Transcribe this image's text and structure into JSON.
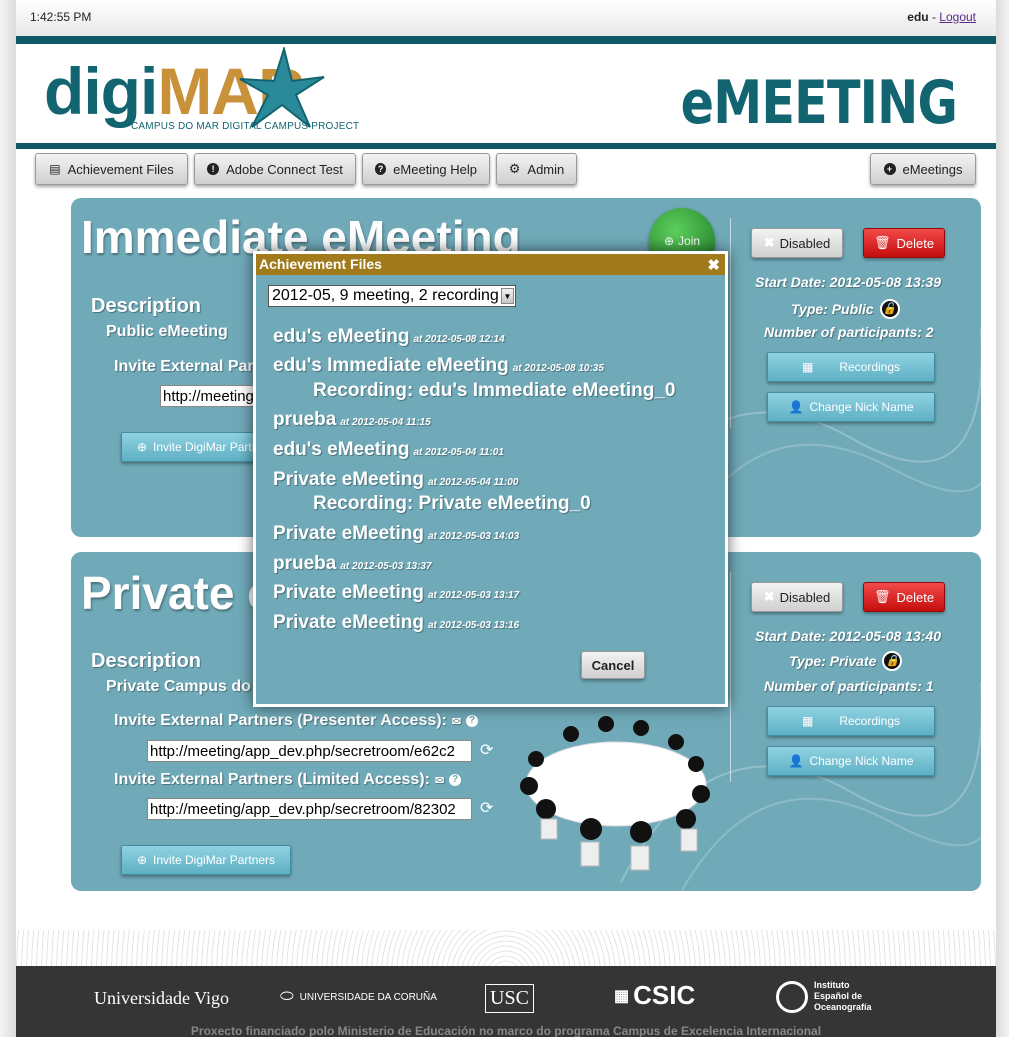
{
  "topbar": {
    "clock": "1:42:55 PM",
    "user": "edu",
    "separator": " - ",
    "logout": "Logout"
  },
  "header": {
    "logo_digi": "digi",
    "logo_mar": "MAR",
    "logo_subtitle": "CAMPUS DO MAR DIGITAL CAMPUS PROJECT",
    "title": "eMEETING"
  },
  "nav": {
    "achievement": "Achievement Files",
    "adobe": "Adobe Connect Test",
    "help": "eMeeting Help",
    "admin": "Admin",
    "emeetings": "eMeetings"
  },
  "panel1": {
    "title": "Immediate eMeeting",
    "join": "Join",
    "description_label": "Description",
    "description": "Public eMeeting",
    "invite_label": "Invite External Partners (Presenter Access):",
    "url": "http://meeting/app_dev.php/secretroom/",
    "invite_btn": "Invite DigiMar Partners",
    "disabled": "Disabled",
    "delete": "Delete",
    "start_date": "Start Date: 2012-05-08 13:39",
    "type": "Type: Public",
    "participants": "Number of participants: 2",
    "recordings": "Recordings",
    "nick": "Change Nick Name"
  },
  "panel2": {
    "title": "Private eMeeting",
    "description_label": "Description",
    "description": "Private Campus do Mar eMeeting",
    "invite_presenter": "Invite External Partners (Presenter Access):",
    "url1": "http://meeting/app_dev.php/secretroom/e62c2",
    "invite_limited": "Invite External Partners (Limited Access):",
    "url2": "http://meeting/app_dev.php/secretroom/82302",
    "invite_btn": "Invite DigiMar Partners",
    "disabled": "Disabled",
    "delete": "Delete",
    "start_date": "Start Date: 2012-05-08 13:40",
    "type": "Type: Private",
    "participants": "Number of participants: 1",
    "recordings": "Recordings",
    "nick": "Change Nick Name"
  },
  "modal": {
    "title": "Achievement Files",
    "close": "✖",
    "select_value": "2012-05, 9 meeting, 2 recording",
    "items": [
      {
        "name": "edu's eMeeting",
        "at": "at 2012-05-08 12:14"
      },
      {
        "name": "edu's Immediate eMeeting",
        "at": "at 2012-05-08 10:35"
      },
      {
        "name": "prueba",
        "at": "at 2012-05-04 11:15"
      },
      {
        "name": "edu's eMeeting",
        "at": "at 2012-05-04 11:01"
      },
      {
        "name": "Private eMeeting",
        "at": "at 2012-05-04 11:00"
      },
      {
        "name": "Private eMeeting",
        "at": "at 2012-05-03 14:03"
      },
      {
        "name": "prueba",
        "at": "at 2012-05-03 13:37"
      },
      {
        "name": "Private eMeeting",
        "at": "at 2012-05-03 13:17"
      },
      {
        "name": "Private eMeeting",
        "at": "at 2012-05-03 13:16"
      }
    ],
    "recordings": [
      "Recording: edu's Immediate eMeeting_0",
      "Recording: Private eMeeting_0"
    ],
    "cancel": "Cancel"
  },
  "footer": {
    "uvigo": "Universidade Vigo",
    "udc": "UNIVERSIDADE DA CORUÑA",
    "usc": "USC",
    "csic": "CSIC",
    "ieo": "Instituto Español de Oceanografía",
    "note": "Proxecto financiado polo Ministerio de Educación no marco do programa Campus de Excelencia Internacional"
  },
  "colors": {
    "teal": "#0f5866",
    "panel": "#70aab9",
    "modal_header": "#a07a1b",
    "delete_red": "#d41515",
    "join_green": "#2e9a3a"
  }
}
